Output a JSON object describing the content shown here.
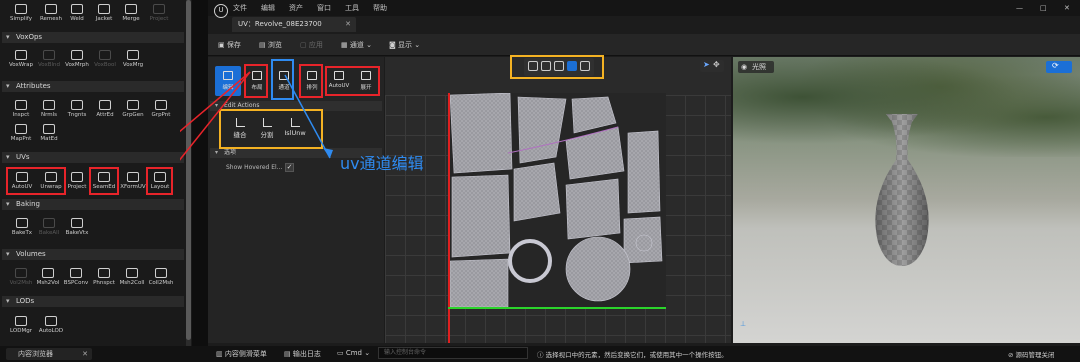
{
  "left_panel": {
    "top_tools": [
      "Simplify",
      "Remesh",
      "Weld",
      "Jacket",
      "Merge",
      "Project"
    ],
    "sections": [
      {
        "title": "VoxOps",
        "tools": [
          "VoxWrap",
          "VoxBlnd",
          "VoxMrph",
          "VoxBool",
          "VoxMrg"
        ]
      },
      {
        "title": "Attributes",
        "tools": [
          "Inspct",
          "Nrmls",
          "Tngnts",
          "AttrEd",
          "GrpGen",
          "GrpPnt",
          "MapPnt",
          "MatEd"
        ]
      },
      {
        "title": "UVs",
        "tools": [
          "AutoUV",
          "Unwrap",
          "Project",
          "SeamEd",
          "XFormUV",
          "Layout"
        ]
      },
      {
        "title": "Baking",
        "tools": [
          "BakeTx",
          "BakeAll",
          "BakeVtx"
        ]
      },
      {
        "title": "Volumes",
        "tools": [
          "Vol2Msh",
          "Msh2Vol",
          "BSPConv",
          "Phnspct",
          "Msh2Coll",
          "Coll2Msh"
        ]
      },
      {
        "title": "LODs",
        "tools": [
          "LODMgr",
          "AutoLOD"
        ]
      }
    ],
    "bottom_tab": "内容浏览器"
  },
  "menubar": [
    "文件",
    "编辑",
    "资产",
    "窗口",
    "工具",
    "帮助"
  ],
  "document_tab": "UV：Revolve_08E23700",
  "toolbar": {
    "save": "保存",
    "browse": "浏览",
    "apply": "应用",
    "channel": "通道",
    "display": "显示"
  },
  "uv_panel": {
    "modes": [
      "编辑",
      "布局",
      "通道",
      "排列",
      "AutoUV",
      "展开"
    ],
    "edit_actions_header": "Edit Actions",
    "actions": [
      "缝合",
      "分割",
      "IslUnw"
    ],
    "options_header": "选项",
    "option_label": "Show Hovered El..."
  },
  "annotation": "uv通道编辑",
  "viewport_3d": {
    "lighting_label": "光照"
  },
  "status_bar": {
    "content_drawer": "内容侧滑菜单",
    "output_log": "输出日志",
    "cmd": "Cmd",
    "cmd_placeholder": "输入控制台命令",
    "hint": "选择视口中的元素，然后变换它们，或使用其中一个操作按钮。",
    "source_control": "源码管理关闭"
  },
  "window_controls": [
    "—",
    "□",
    "✕"
  ],
  "colors": {
    "accent": "#1b6fd6",
    "highlight_red": "#e8242a",
    "highlight_yellow": "#f4b223",
    "annotation_blue": "#2f8bf0"
  }
}
